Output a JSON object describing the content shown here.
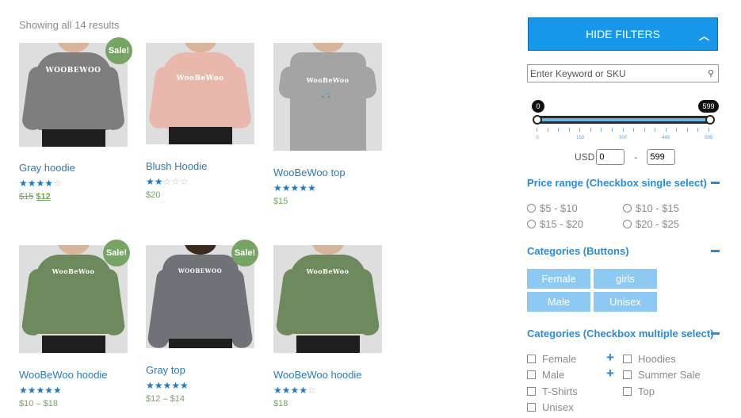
{
  "results": {
    "text": "Showing all 14 results"
  },
  "products": [
    {
      "title": "Gray hoodie",
      "sale": true,
      "sale_label": "Sale!",
      "rating": 4,
      "price_old": "$15",
      "price_new": "$12",
      "price": "",
      "print": "WOOBEWOO",
      "color": "#7e7e7e"
    },
    {
      "title": "Blush Hoodie",
      "sale": false,
      "sale_label": "",
      "rating": 2,
      "price_old": "",
      "price_new": "",
      "price": "$20",
      "print": "WooBeWoo",
      "color": "#e9b8ad"
    },
    {
      "title": "WooBeWoo top",
      "sale": false,
      "sale_label": "",
      "rating": 5,
      "price_old": "",
      "price_new": "",
      "price": "$15",
      "print": "WooBeWoo",
      "color": "#a4a4a4"
    },
    {
      "title": "WooBeWoo hoodie",
      "sale": true,
      "sale_label": "Sale!",
      "rating": 5,
      "price_old": "",
      "price_new": "",
      "price": "$10 – $18",
      "print": "WooBeWoo",
      "color": "#6d8a5d"
    },
    {
      "title": "Gray top",
      "sale": true,
      "sale_label": "Sale!",
      "rating": 5,
      "price_old": "",
      "price_new": "",
      "price": "$12 – $14",
      "print": "WOOBEWOO",
      "color": "#6f7276"
    },
    {
      "title": "WooBeWoo hoodie",
      "sale": false,
      "sale_label": "",
      "rating": 4,
      "price_old": "",
      "price_new": "",
      "price": "$18",
      "print": "WooBeWoo",
      "color": "#6d8a5d"
    }
  ],
  "sidebar": {
    "hide_filters_label": "HIDE FILTERS",
    "search_placeholder": "Enter Keyword or SKU",
    "slider": {
      "min_bubble": "0",
      "max_bubble": "599",
      "tick_labels": [
        "0",
        "150",
        "300",
        "449",
        "599"
      ],
      "currency": "USD",
      "min_value": "0",
      "max_value": "599",
      "dash": "-"
    },
    "price_range": {
      "title": "Price range (Checkbox single select)",
      "options": [
        "$5 - $10",
        "$10 - $15",
        "$15 - $20",
        "$20 - $25"
      ]
    },
    "categories_buttons": {
      "title": "Categories (Buttons)",
      "buttons": [
        "Female",
        "girls",
        "Male",
        "Unisex"
      ]
    },
    "categories_checkbox": {
      "title": "Categories (Checkbox multiple select)",
      "left": [
        "Female",
        "Male",
        "T-Shirts",
        "Unisex"
      ],
      "right": [
        "Hoodies",
        "Summer Sale",
        "Top"
      ]
    }
  },
  "colors": {
    "accent": "#1697ea",
    "link": "#2a7ab5",
    "sale": "#77a464",
    "button_light": "#8ec9f3"
  }
}
